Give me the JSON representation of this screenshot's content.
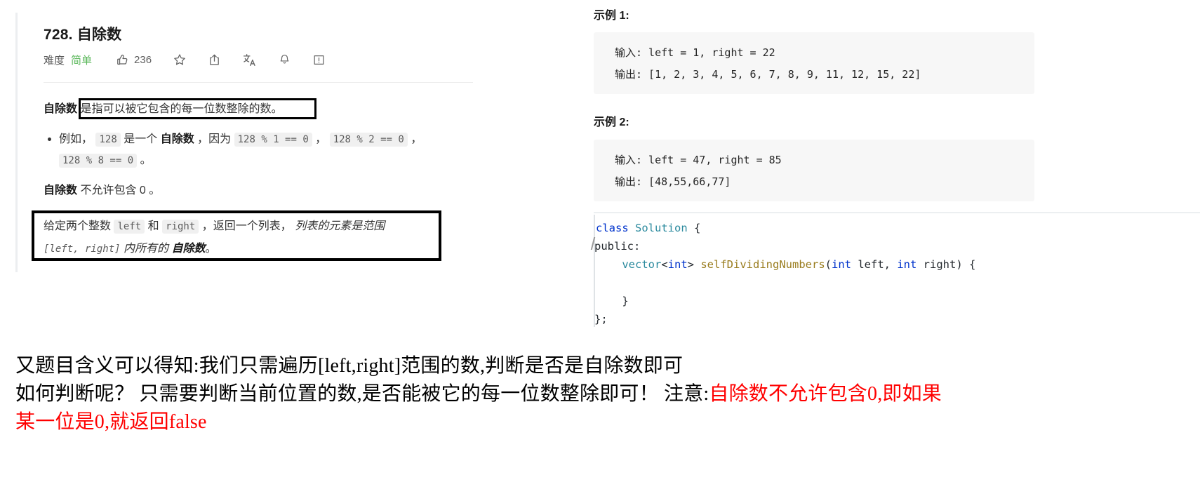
{
  "problem": {
    "title": "728. 自除数",
    "meta": {
      "difficulty_label": "难度",
      "difficulty_value": "简单",
      "difficulty_color": "#5cb85c",
      "likes_count": "236",
      "icons": [
        "thumbs-up-icon",
        "star-icon",
        "share-icon",
        "translate-icon",
        "bell-icon",
        "feedback-icon"
      ]
    },
    "definition": {
      "term": "自除数",
      "clause": "是指可以被它包含的每一位数整除的数。",
      "highlighted": true
    },
    "example_bullet": {
      "prefix": "例如，",
      "code_1": "128",
      "mid_1": "是一个",
      "term": "自除数",
      "mid_2": "，因为",
      "code_2": "128 % 1 == 0",
      "comma_1": "，",
      "code_3": "128 % 2 == 0",
      "comma_2": "，",
      "code_4": "128 % 8 == 0",
      "suffix": "。"
    },
    "no_zero": {
      "term": "自除数",
      "text": "不允许包含 0 。"
    },
    "return_statement": {
      "line1_a": "给定两个整数",
      "code_left": "left",
      "line1_b": "和",
      "code_right": "right",
      "line1_c": "，返回一个列表，",
      "line1_italic": "列表的元素是范",
      "line2_italic_a": "围",
      "code_range": "[left, right]",
      "line2_italic_b": "内所有的",
      "line2_bold": "自除数",
      "line2_end": "。",
      "highlighted": true
    }
  },
  "examples": [
    {
      "heading": "示例 1:",
      "input_label": "输入:",
      "input_value": " left = 1, right = 22",
      "output_label": "输出:",
      "output_value": " [1, 2, 3, 4, 5, 6, 7, 8, 9, 11, 12, 15, 22]"
    },
    {
      "heading": "示例 2:",
      "input_label": "输入:",
      "input_value": " left = 47, right = 85",
      "output_label": "输出:",
      "output_value": " [48,55,66,77]"
    }
  ],
  "code": {
    "language": "cpp",
    "line1": {
      "kw": "class",
      "name": "Solution",
      "brace": "{"
    },
    "line2": "public:",
    "line3": {
      "indent": "    ",
      "type": "vector",
      "lt": "<",
      "inner": "int",
      "gt": "> ",
      "fn": "selfDividingNumbers",
      "paren_open": "(",
      "p1_type": "int",
      "p1_name": " left, ",
      "p2_type": "int",
      "p2_name": " right",
      "paren_close": ") {"
    },
    "line4": "    }",
    "line5": "};"
  },
  "notes": {
    "line1": "又题目含义可以得知:我们只需遍历[left,right]范围的数,判断是否是自除数即可",
    "line2_part1": "如何判断呢？  只需要判断当前位置的数,是否能被它的每一位数整除即可！  注意:",
    "line2_red": "自除数不允许包含0,即如果",
    "line3_red": "某一位是0,就返回false",
    "red_color": "#ff0000"
  }
}
